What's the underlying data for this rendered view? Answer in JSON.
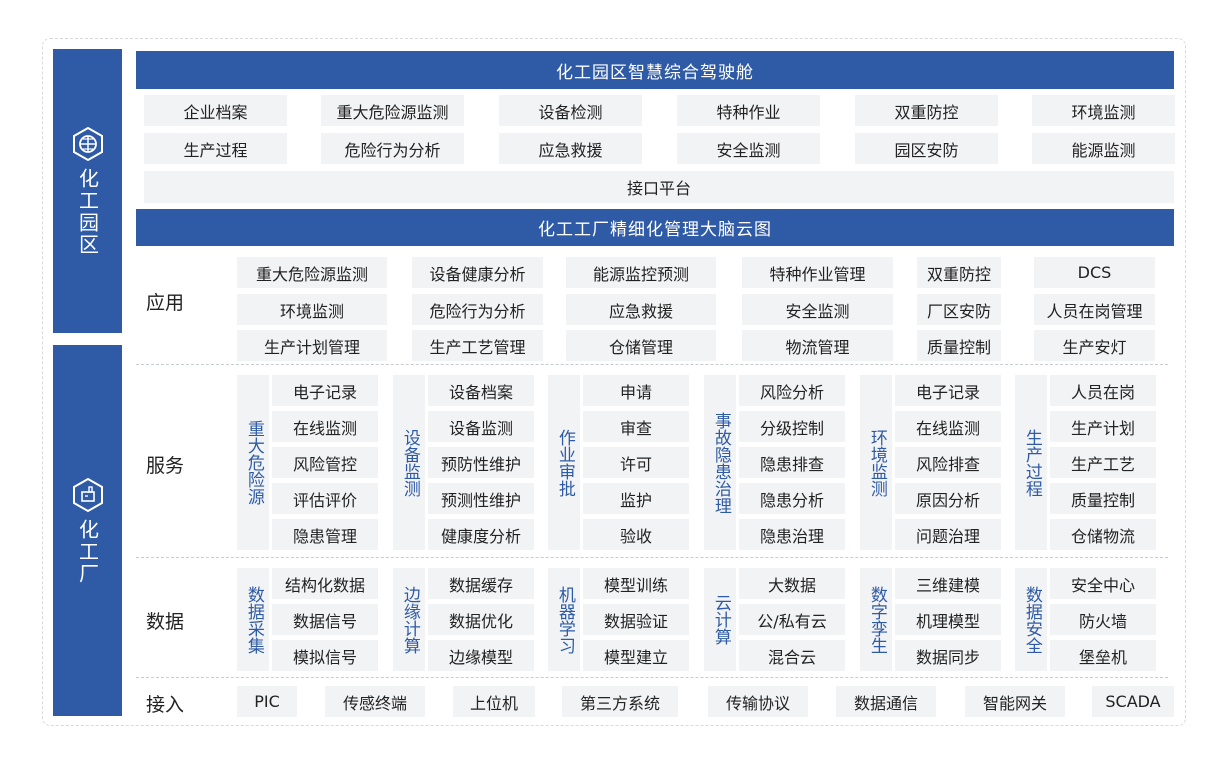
{
  "sidebar": {
    "park_label": "化工园区",
    "factory_label": "化工厂",
    "park_icon": "hexagon-grid-icon",
    "factory_icon": "hexagon-factory-icon"
  },
  "park": {
    "title": "化工园区智慧综合驾驶舱",
    "items": [
      [
        "企业档案",
        "重大危险源监测",
        "设备检测",
        "特种作业",
        "双重防控",
        "环境监测"
      ],
      [
        "生产过程",
        "危险行为分析",
        "应急救援",
        "安全监测",
        "园区安防",
        "能源监测"
      ]
    ],
    "interface": "接口平台"
  },
  "factory": {
    "title": "化工工厂精细化管理大脑云图",
    "application": {
      "label": "应用",
      "items": [
        [
          "重大危险源监测",
          "设备健康分析",
          "能源监控预测",
          "特种作业管理",
          "双重防控",
          "DCS"
        ],
        [
          "环境监测",
          "危险行为分析",
          "应急救援",
          "安全监测",
          "厂区安防",
          "人员在岗管理"
        ],
        [
          "生产计划管理",
          "生产工艺管理",
          "仓储管理",
          "物流管理",
          "质量控制",
          "生产安灯"
        ]
      ]
    },
    "service": {
      "label": "服务",
      "groups": [
        {
          "category": "重大危险源",
          "items": [
            "电子记录",
            "在线监测",
            "风险管控",
            "评估评价",
            "隐患管理"
          ]
        },
        {
          "category": "设备监测",
          "items": [
            "设备档案",
            "设备监测",
            "预防性维护",
            "预测性维护",
            "健康度分析"
          ]
        },
        {
          "category": "作业审批",
          "items": [
            "申请",
            "审查",
            "许可",
            "监护",
            "验收"
          ]
        },
        {
          "category": "事故隐患治理",
          "items": [
            "风险分析",
            "分级控制",
            "隐患排查",
            "隐患分析",
            "隐患治理"
          ]
        },
        {
          "category": "环境监测",
          "items": [
            "电子记录",
            "在线监测",
            "风险排查",
            "原因分析",
            "问题治理"
          ]
        },
        {
          "category": "生产过程",
          "items": [
            "人员在岗",
            "生产计划",
            "生产工艺",
            "质量控制",
            "仓储物流"
          ]
        }
      ]
    },
    "data": {
      "label": "数据",
      "groups": [
        {
          "category": "数据采集",
          "items": [
            "结构化数据",
            "数据信号",
            "模拟信号"
          ]
        },
        {
          "category": "边缘计算",
          "items": [
            "数据缓存",
            "数据优化",
            "边缘模型"
          ]
        },
        {
          "category": "机器学习",
          "items": [
            "模型训练",
            "数据验证",
            "模型建立"
          ]
        },
        {
          "category": "云计算",
          "items": [
            "大数据",
            "公/私有云",
            "混合云"
          ]
        },
        {
          "category": "数字孪生",
          "items": [
            "三维建模",
            "机理模型",
            "数据同步"
          ]
        },
        {
          "category": "数据安全",
          "items": [
            "安全中心",
            "防火墙",
            "堡垒机"
          ]
        }
      ]
    },
    "access": {
      "label": "接入",
      "items": [
        "PIC",
        "传感终端",
        "上位机",
        "第三方系统",
        "传输协议",
        "数据通信",
        "智能网关",
        "SCADA"
      ]
    }
  }
}
